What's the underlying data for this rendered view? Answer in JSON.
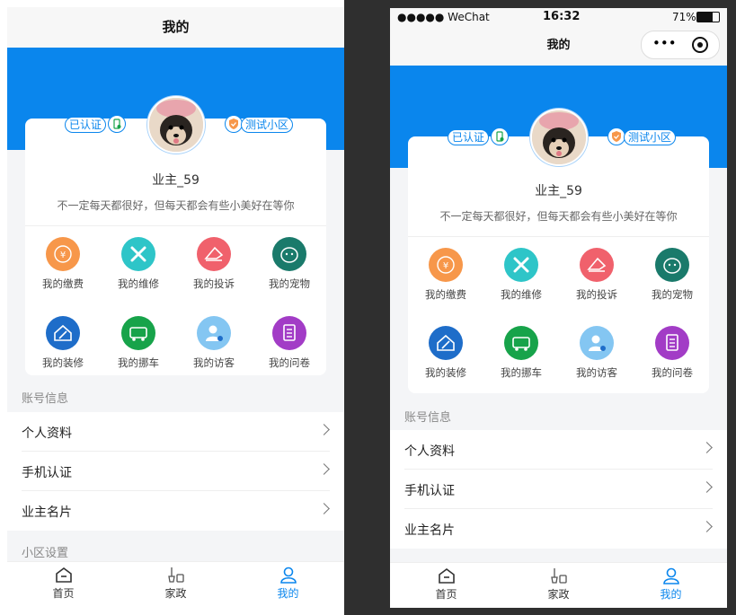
{
  "navbar": {
    "title": "我的"
  },
  "status_bar": {
    "carrier": "●●●●● WeChat",
    "time": "16:32",
    "battery": "71%"
  },
  "profile": {
    "verified_label": "已认证",
    "community_label": "测试小区",
    "username": "业主_59",
    "motto": "不一定每天都很好，但每天都会有些小美好在等你"
  },
  "grid": [
    {
      "label": "我的缴费",
      "icon": "yen-payment-icon",
      "color": "#f7974a"
    },
    {
      "label": "我的维修",
      "icon": "tools-repair-icon",
      "color": "#2ec5c8"
    },
    {
      "label": "我的投诉",
      "icon": "complaint-icon",
      "color": "#f0616c"
    },
    {
      "label": "我的宠物",
      "icon": "pet-icon",
      "color": "#1a7a6b"
    },
    {
      "label": "我的装修",
      "icon": "house-renovation-icon",
      "color": "#1e6dc9"
    },
    {
      "label": "我的挪车",
      "icon": "car-move-icon",
      "color": "#17a34a"
    },
    {
      "label": "我的访客",
      "icon": "visitor-icon",
      "color": "#84c6f2"
    },
    {
      "label": "我的问卷",
      "icon": "questionnaire-icon",
      "color": "#a23cc6"
    }
  ],
  "account_section": {
    "title": "账号信息",
    "rows": [
      "个人资料",
      "手机认证",
      "业主名片"
    ]
  },
  "community_section": {
    "title": "小区设置"
  },
  "tabbar": [
    {
      "label": "首页",
      "icon": "home-icon"
    },
    {
      "label": "家政",
      "icon": "housekeeping-icon"
    },
    {
      "label": "我的",
      "icon": "user-icon"
    }
  ],
  "colors": {
    "brand": "#0a86ed",
    "background": "#f4f5f7"
  }
}
